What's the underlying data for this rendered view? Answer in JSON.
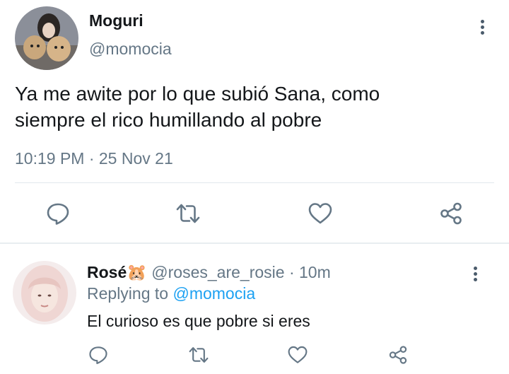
{
  "tweet": {
    "author_name": "Moguri",
    "author_handle": "@momocia",
    "text": "Ya me awite por lo que subió Sana, como siempre el rico humillando al pobre",
    "timestamp": "10:19 PM · 25 Nov 21",
    "actions": [
      "reply-icon",
      "retweet-icon",
      "like-icon",
      "share-icon"
    ]
  },
  "reply": {
    "author_name": "Rosé🐹",
    "author_handle": "@roses_are_rosie",
    "separator": "·",
    "age": "10m",
    "replying_prefix": "Replying to",
    "replying_handle": "@momocia",
    "text": "El curioso es que pobre si eres",
    "actions": [
      "reply-icon",
      "retweet-icon",
      "like-icon",
      "share-icon"
    ]
  },
  "colors": {
    "text": "#14171a",
    "muted": "#657786",
    "link": "#1da1f2",
    "divider": "#e1e8ed"
  }
}
